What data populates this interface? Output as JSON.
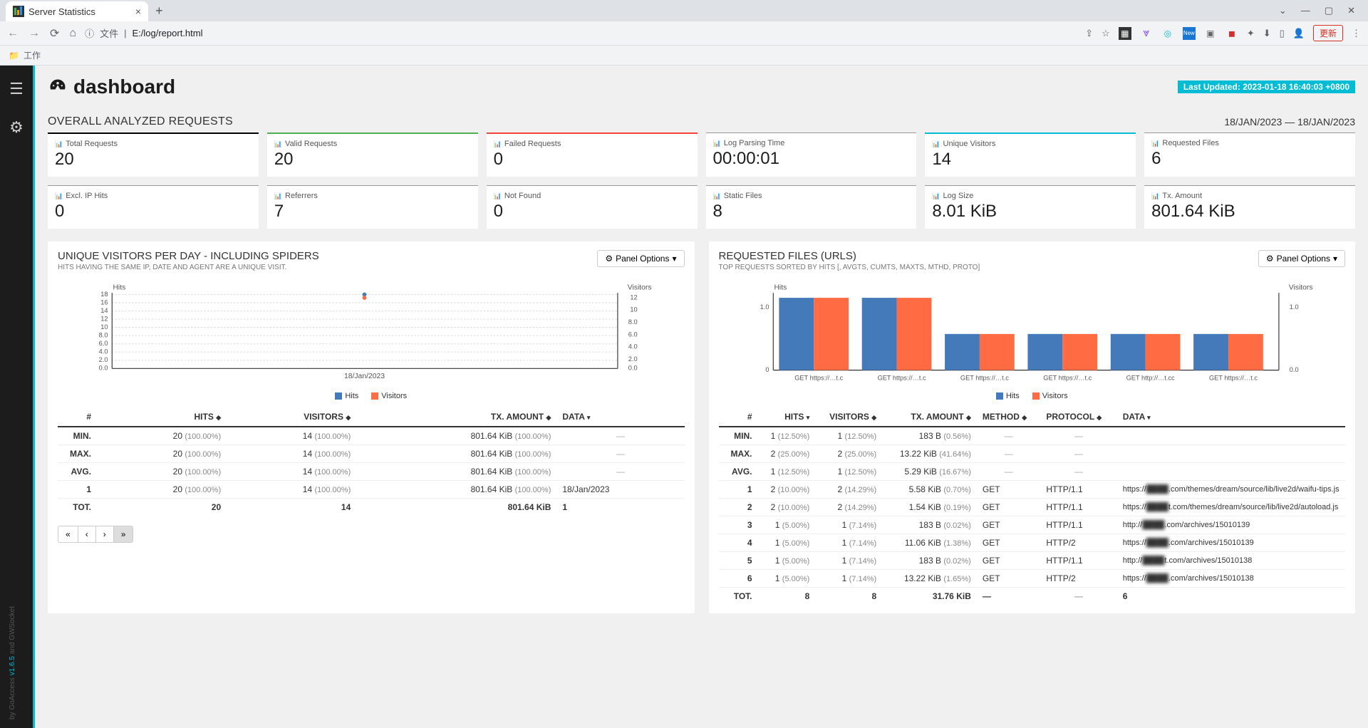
{
  "browser": {
    "tab_title": "Server Statistics",
    "url_label": "文件",
    "url": "E:/log/report.html",
    "update_btn": "更新",
    "bookmark_folder": "工作"
  },
  "header": {
    "title": "dashboard",
    "last_updated_label": "Last Updated:",
    "last_updated_value": "2023-01-18 16:40:03 +0800"
  },
  "overall": {
    "title": "OVERALL ANALYZED REQUESTS",
    "date_range": "18/JAN/2023 — 18/JAN/2023",
    "cards": [
      {
        "label": "Total Requests",
        "value": "20",
        "color": "black"
      },
      {
        "label": "Valid Requests",
        "value": "20",
        "color": "green"
      },
      {
        "label": "Failed Requests",
        "value": "0",
        "color": "red"
      },
      {
        "label": "Log Parsing Time",
        "value": "00:00:01",
        "color": ""
      },
      {
        "label": "Unique Visitors",
        "value": "14",
        "color": "cyan"
      },
      {
        "label": "Requested Files",
        "value": "6",
        "color": ""
      },
      {
        "label": "Excl. IP Hits",
        "value": "0",
        "color": ""
      },
      {
        "label": "Referrers",
        "value": "7",
        "color": ""
      },
      {
        "label": "Not Found",
        "value": "0",
        "color": ""
      },
      {
        "label": "Static Files",
        "value": "8",
        "color": ""
      },
      {
        "label": "Log Size",
        "value": "8.01 KiB",
        "color": ""
      },
      {
        "label": "Tx. Amount",
        "value": "801.64 KiB",
        "color": ""
      }
    ]
  },
  "visitors_panel": {
    "title": "UNIQUE VISITORS PER DAY - INCLUDING SPIDERS",
    "subtitle": "HITS HAVING THE SAME IP, DATE AND AGENT ARE A UNIQUE VISIT.",
    "panel_options": "Panel Options",
    "legend": {
      "hits": "Hits",
      "visitors": "Visitors"
    },
    "columns": [
      "#",
      "HITS",
      "VISITORS",
      "TX. AMOUNT",
      "DATA"
    ],
    "stats": [
      {
        "label": "MIN.",
        "hits": "20",
        "hits_pct": "(100.00%)",
        "vis": "14",
        "vis_pct": "(100.00%)",
        "tx": "801.64 KiB",
        "tx_pct": "(100.00%)",
        "data": "—"
      },
      {
        "label": "MAX.",
        "hits": "20",
        "hits_pct": "(100.00%)",
        "vis": "14",
        "vis_pct": "(100.00%)",
        "tx": "801.64 KiB",
        "tx_pct": "(100.00%)",
        "data": "—"
      },
      {
        "label": "AVG.",
        "hits": "20",
        "hits_pct": "(100.00%)",
        "vis": "14",
        "vis_pct": "(100.00%)",
        "tx": "801.64 KiB",
        "tx_pct": "(100.00%)",
        "data": "—"
      }
    ],
    "rows": [
      {
        "n": "1",
        "hits": "20",
        "hits_pct": "(100.00%)",
        "vis": "14",
        "vis_pct": "(100.00%)",
        "tx": "801.64 KiB",
        "tx_pct": "(100.00%)",
        "data": "18/Jan/2023"
      }
    ],
    "total": {
      "label": "TOT.",
      "hits": "20",
      "vis": "14",
      "tx": "801.64 KiB",
      "data": "1"
    }
  },
  "files_panel": {
    "title": "REQUESTED FILES (URLS)",
    "subtitle": "TOP REQUESTS SORTED BY HITS [, AVGTS, CUMTS, MAXTS, MTHD, PROTO]",
    "panel_options": "Panel Options",
    "legend": {
      "hits": "Hits",
      "visitors": "Visitors"
    },
    "columns": [
      "#",
      "HITS",
      "VISITORS",
      "TX. AMOUNT",
      "METHOD",
      "PROTOCOL",
      "DATA"
    ],
    "stats": [
      {
        "label": "MIN.",
        "hits": "1",
        "hits_pct": "(12.50%)",
        "vis": "1",
        "vis_pct": "(12.50%)",
        "tx": "183 B",
        "tx_pct": "(0.56%)",
        "method": "—",
        "proto": "—"
      },
      {
        "label": "MAX.",
        "hits": "2",
        "hits_pct": "(25.00%)",
        "vis": "2",
        "vis_pct": "(25.00%)",
        "tx": "13.22 KiB",
        "tx_pct": "(41.64%)",
        "method": "—",
        "proto": "—"
      },
      {
        "label": "AVG.",
        "hits": "1",
        "hits_pct": "(12.50%)",
        "vis": "1",
        "vis_pct": "(12.50%)",
        "tx": "5.29 KiB",
        "tx_pct": "(16.67%)",
        "method": "—",
        "proto": "—"
      }
    ],
    "rows": [
      {
        "n": "1",
        "hits": "2",
        "hits_pct": "(10.00%)",
        "vis": "2",
        "vis_pct": "(14.29%)",
        "tx": "5.58 KiB",
        "tx_pct": "(0.70%)",
        "method": "GET",
        "proto": "HTTP/1.1",
        "url_prefix": "https://",
        "url_mid": "████",
        "url_suffix": ".com/themes/dream/source/lib/live2d/waifu-tips.js"
      },
      {
        "n": "2",
        "hits": "2",
        "hits_pct": "(10.00%)",
        "vis": "2",
        "vis_pct": "(14.29%)",
        "tx": "1.54 KiB",
        "tx_pct": "(0.19%)",
        "method": "GET",
        "proto": "HTTP/1.1",
        "url_prefix": "https://",
        "url_mid": "████",
        "url_suffix": "t.com/themes/dream/source/lib/live2d/autoload.js"
      },
      {
        "n": "3",
        "hits": "1",
        "hits_pct": "(5.00%)",
        "vis": "1",
        "vis_pct": "(7.14%)",
        "tx": "183 B",
        "tx_pct": "(0.02%)",
        "method": "GET",
        "proto": "HTTP/1.1",
        "url_prefix": "http://",
        "url_mid": "████",
        "url_suffix": ".com/archives/15010139"
      },
      {
        "n": "4",
        "hits": "1",
        "hits_pct": "(5.00%)",
        "vis": "1",
        "vis_pct": "(7.14%)",
        "tx": "11.06 KiB",
        "tx_pct": "(1.38%)",
        "method": "GET",
        "proto": "HTTP/2",
        "url_prefix": "https://",
        "url_mid": "████",
        "url_suffix": ".com/archives/15010139"
      },
      {
        "n": "5",
        "hits": "1",
        "hits_pct": "(5.00%)",
        "vis": "1",
        "vis_pct": "(7.14%)",
        "tx": "183 B",
        "tx_pct": "(0.02%)",
        "method": "GET",
        "proto": "HTTP/1.1",
        "url_prefix": "http://",
        "url_mid": "████",
        "url_suffix": "t.com/archives/15010138"
      },
      {
        "n": "6",
        "hits": "1",
        "hits_pct": "(5.00%)",
        "vis": "1",
        "vis_pct": "(7.14%)",
        "tx": "13.22 KiB",
        "tx_pct": "(1.65%)",
        "method": "GET",
        "proto": "HTTP/2",
        "url_prefix": "https://",
        "url_mid": "████",
        "url_suffix": ".com/archives/15010138"
      }
    ],
    "total": {
      "label": "TOT.",
      "hits": "8",
      "vis": "8",
      "tx": "31.76 KiB",
      "method": "—",
      "proto": "—",
      "data": "6"
    }
  },
  "chart_data": [
    {
      "type": "bar",
      "title": "Unique Visitors Per Day",
      "x_label": "18/Jan/2023",
      "left_axis_label": "Hits",
      "right_axis_label": "Visitors",
      "left_ticks": [
        0.0,
        2.0,
        4.0,
        6.0,
        8.0,
        10.0,
        12.0,
        14.0,
        16.0,
        18.0
      ],
      "right_ticks": [
        0.0,
        2.0,
        4.0,
        6.0,
        8.0,
        10.0,
        12.0
      ],
      "series": [
        {
          "name": "Hits",
          "color": "#447ab9",
          "values": [
            20
          ]
        },
        {
          "name": "Visitors",
          "color": "#ff6c44",
          "values": [
            14
          ]
        }
      ],
      "categories": [
        "18/Jan/2023"
      ]
    },
    {
      "type": "bar",
      "title": "Requested Files",
      "left_axis_label": "Hits",
      "right_axis_label": "Visitors",
      "left_ticks": [
        0,
        1.0
      ],
      "right_ticks": [
        0.0,
        1.0
      ],
      "categories": [
        "GET https://…t.c",
        "GET https://…t.c",
        "GET https://…t.c",
        "GET https://…t.c",
        "GET http://…t.cc",
        "GET https://…t.c"
      ],
      "series": [
        {
          "name": "Hits",
          "color": "#447ab9",
          "values": [
            2,
            2,
            1,
            1,
            1,
            1
          ]
        },
        {
          "name": "Visitors",
          "color": "#ff6c44",
          "values": [
            2,
            2,
            1,
            1,
            1,
            1
          ]
        }
      ]
    }
  ]
}
